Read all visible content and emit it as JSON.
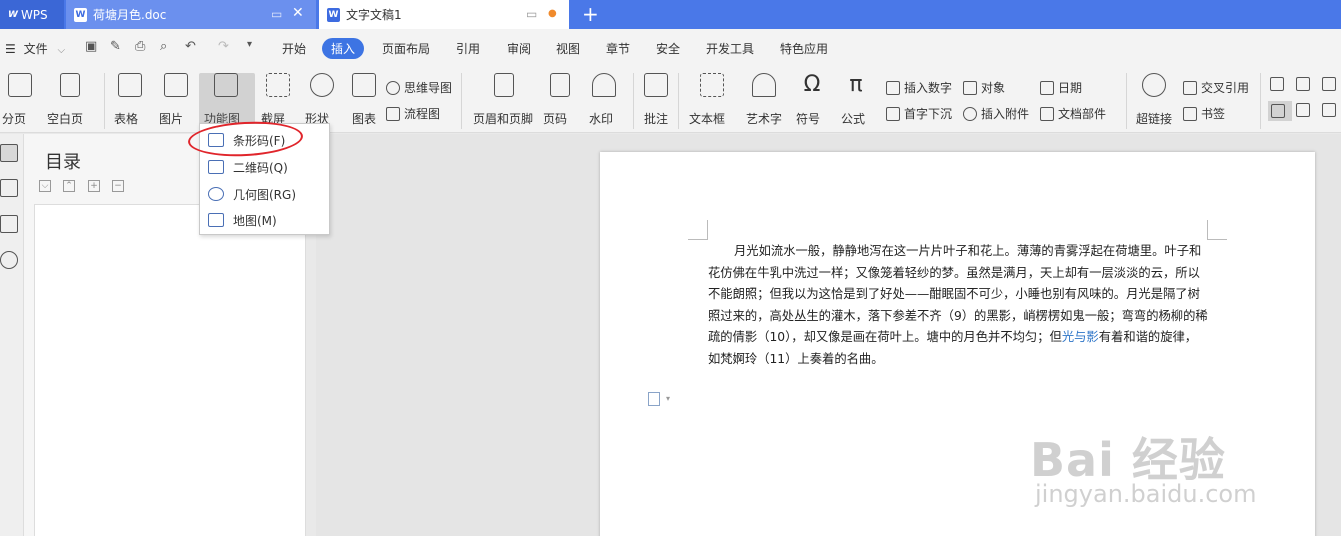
{
  "titlebar": {
    "wps_tab": "WPS",
    "doc_tab_1": "荷塘月色.doc",
    "doc_tab_2": "文字文稿1",
    "add_tab": "+"
  },
  "menubar": {
    "file": "文件",
    "tabs": [
      "开始",
      "插入",
      "页面布局",
      "引用",
      "审阅",
      "视图",
      "章节",
      "安全",
      "开发工具",
      "特色应用"
    ],
    "active_tab": "插入"
  },
  "ribbon": {
    "page_break": "分页",
    "blank_page": "空白页",
    "table": "表格",
    "picture": "图片",
    "function_chart": "功能图",
    "screenshot": "截屏",
    "shape": "形状",
    "chart": "图表",
    "mind_map": "思维导图",
    "flowchart": "流程图",
    "header_footer": "页眉和页脚",
    "page_number": "页码",
    "watermark": "水印",
    "comment": "批注",
    "text_box": "文本框",
    "word_art": "艺术字",
    "symbol": "符号",
    "formula": "公式",
    "insert_number": "插入数字",
    "drop_cap": "首字下沉",
    "object": "对象",
    "insert_attachment": "插入附件",
    "date": "日期",
    "doc_parts": "文档部件",
    "hyperlink": "超链接",
    "cross_ref": "交叉引用",
    "bookmark": "书签"
  },
  "dropdown": {
    "items": [
      "条形码(F)",
      "二维码(Q)",
      "几何图(RG)",
      "地图(M)"
    ]
  },
  "navpane": {
    "title": "目录"
  },
  "document": {
    "text_before": "月光如流水一般，静静地泻在这一片片叶子和花上。薄薄的青雾浮起在荷塘里。叶子和花仿佛在牛乳中洗过一样；又像笼着轻纱的梦。虽然是满月，天上却有一层淡淡的云，所以不能朗照；但我以为这恰是到了好处——酣眠固不可少，小睡也别有风味的。月光是隔了树照过来的，高处丛生的灌木，落下参差不齐（9）的黑影，峭楞楞如鬼一般；弯弯的杨柳的稀疏的倩影（10），却又像是画在荷叶上。塘中的月色并不均匀；但",
    "text_link": "光与影",
    "text_after": "有着和谐的旋律，如梵婀玲（11）上奏着的名曲。"
  },
  "watermark": {
    "main": "Bai 经验",
    "url": "jingyan.baidu.com"
  },
  "colors": {
    "titlebar": "#4a78e8",
    "active_tab": "#3d74e3",
    "annotation_circle": "#e0252b"
  }
}
